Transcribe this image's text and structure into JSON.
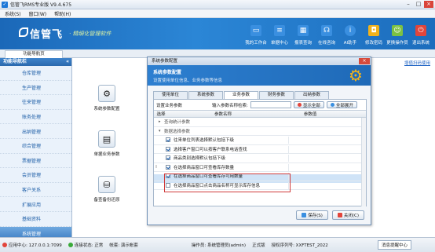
{
  "window": {
    "title": "信管飞RMS专业版 V9.4.675",
    "controls": [
      "–",
      "□",
      "×"
    ]
  },
  "menu": [
    "系统(S)",
    "窗口(W)",
    "帮助(H)"
  ],
  "banner": {
    "logo": "信管飞",
    "slogan": "· 精细化管理软件",
    "tools": [
      {
        "label": "我的工作台",
        "icon": "monitor-icon",
        "color": "#3a8fe0"
      },
      {
        "label": "单据中心",
        "icon": "document-icon",
        "color": "#3a8fe0"
      },
      {
        "label": "报表查询",
        "icon": "table-icon",
        "color": "#3a8fe0"
      },
      {
        "label": "在线咨询",
        "icon": "headset-icon",
        "color": "#3a8fe0"
      },
      {
        "label": "AI助手",
        "icon": "info-icon",
        "color": "#3a8fe0"
      },
      {
        "label": "修改密码",
        "icon": "lock-icon",
        "color": "#f1b21c"
      },
      {
        "label": "更换操作员",
        "icon": "users-icon",
        "color": "#7cc142"
      },
      {
        "label": "退出系统",
        "icon": "power-icon",
        "color": "#e2453b"
      }
    ]
  },
  "tabs": {
    "home": "功能导航页"
  },
  "sidebar": {
    "header": "功能导航栏",
    "items": [
      "仓库管理",
      "生产管理",
      "往来管理",
      "账务处理",
      "出纳管理",
      "综合管理",
      "票据管理",
      "会员管理",
      "客户关系",
      "扩展应用",
      "基础资料",
      "系统管理"
    ],
    "active_index": 11
  },
  "main": {
    "link": "增值扫码使用",
    "modules": [
      "系统参数配置",
      "单据业务参数",
      "备查备份还原"
    ]
  },
  "dialog": {
    "title": "系统参数配置",
    "header_title": "系统参数配置",
    "header_subtitle": "设置使用单位信息、业务参数等信息",
    "tabs": [
      "使用单位",
      "系统参数",
      "业务参数",
      "财务参数",
      "出纳参数"
    ],
    "active_tab": 2,
    "toolbar": {
      "label": "设置业务参数",
      "search_label": "输入参数名称检索:",
      "search_value": "",
      "show_all": "显示全部",
      "expand_all": "全部展开"
    },
    "columns": [
      "选择",
      "参数名称",
      "参数值"
    ],
    "rows": [
      {
        "type": "group",
        "toggle": "▸",
        "label": "查询统计参数"
      },
      {
        "type": "group",
        "toggle": "▾",
        "label": "数据选择参数"
      },
      {
        "type": "item",
        "checked": true,
        "label": "往来单位列表选择默认包括下级"
      },
      {
        "type": "item",
        "checked": true,
        "label": "选择客户窗口可以按客户联系电话查找"
      },
      {
        "type": "item",
        "checked": true,
        "label": "商品类别选择默认包括下级"
      },
      {
        "type": "item",
        "checked": true,
        "label": "在选择商品窗口可查看库存数量",
        "gutter": "I"
      },
      {
        "type": "item",
        "checked": true,
        "label": "在选择商品窗口可查看库存可用数量"
      },
      {
        "type": "item",
        "checked": false,
        "label": "在选择商品窗口点击商品名称可显示库存信息"
      }
    ],
    "selected_row": 5,
    "buttons": {
      "save": "保存(S)",
      "close": "关闭(C)"
    }
  },
  "status": {
    "server": "应用中心: 127.0.0.1:7099",
    "connection": "连接状态: 正常",
    "account": "帐套: 演示帐套",
    "operator": "操作员: 系统管理员(admin)",
    "version": "正式版",
    "license": "授权序列号: XXFTEST_2022",
    "message": "消息提醒中心"
  }
}
